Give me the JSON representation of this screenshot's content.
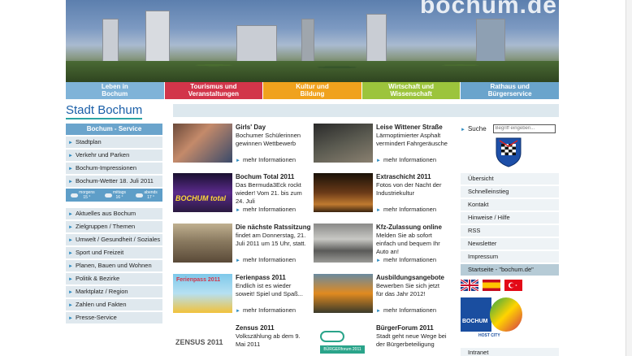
{
  "header": {
    "watermark": "bochum.de"
  },
  "mainnav": [
    {
      "line1": "Leben in",
      "line2": "Bochum",
      "color": "#7fb3d8"
    },
    {
      "line1": "Tourismus und",
      "line2": "Veranstaltungen",
      "color": "#d2354a"
    },
    {
      "line1": "Kultur und",
      "line2": "Bildung",
      "color": "#f0a21d"
    },
    {
      "line1": "Wirtschaft und",
      "line2": "Wissenschaft",
      "color": "#9cc43c"
    },
    {
      "line1": "Rathaus und",
      "line2": "Bürgerservice",
      "color": "#6aa4cc"
    }
  ],
  "logo": "Stadt Bochum",
  "leftnav": {
    "head": "Bochum - Service",
    "items": [
      "Stadtplan",
      "Verkehr und Parken",
      "Bochum-Impressionen",
      "Bochum-Wetter  18. Juli 2011"
    ],
    "weather": [
      {
        "label": "morgens",
        "temp": "15 °"
      },
      {
        "label": "mittags",
        "temp": "16 °"
      },
      {
        "label": "abends",
        "temp": "17 °"
      }
    ],
    "items2": [
      "Aktuelles aus Bochum",
      "Zielgruppen / Themen",
      "Umwelt / Gesundheit / Soziales",
      "Sport und Freizeit",
      "Planen, Bauen und Wohnen",
      "Politik & Bezirke",
      "Marktplatz / Region",
      "Zahlen und Fakten",
      "Presse-Service"
    ]
  },
  "news": [
    {
      "title": "Girls' Day",
      "text": "Bochumer Schülerinnen gewinnen Wettbewerb",
      "more": "mehr Informationen"
    },
    {
      "title": "Leise Wittener Straße",
      "text": "Lärmoptimierter Asphalt vermindert Fahrgeräusche",
      "more": "mehr Informationen"
    },
    {
      "title": "Bochum Total 2011",
      "text": "Das Bermuda3Eck rockt wieder! Vom 21. bis zum 24. Juli",
      "more": "mehr Informationen",
      "thumb_text": "BOCHUM total"
    },
    {
      "title": "Extraschicht 2011",
      "text": "Fotos von der Nacht der Industriekultur",
      "more": "mehr Informationen"
    },
    {
      "title": "Die nächste Ratssitzung",
      "text": "findet am Donnerstag, 21. Juli 2011 um 15 Uhr, statt.",
      "more": "mehr Informationen"
    },
    {
      "title": "Kfz-Zulassung online",
      "text": "Melden Sie ab sofort einfach und bequem Ihr Auto an!",
      "more": "mehr Informationen"
    },
    {
      "title": "Ferienpass 2011",
      "text": "Endlich ist es wieder soweit! Spiel und Spaß...",
      "more": "mehr Informationen",
      "thumb_text": "Ferienpass 2011"
    },
    {
      "title": "Ausbildungsangebote",
      "text": "Bewerben Sie sich jetzt für das Jahr 2012!",
      "more": "mehr Informationen"
    },
    {
      "title": "Zensus 2011",
      "text": "Volkszählung ab dem 9. Mai 2011",
      "more": "",
      "thumb_text": "ZENSUS 2011"
    },
    {
      "title": "BürgerForum 2011",
      "text": "Stadt geht neue Wege bei der Bürgerbeteiligung",
      "more": "",
      "thumb_text": "BÜRGERforum 2011"
    }
  ],
  "search": {
    "label": "Suche",
    "placeholder": "Begriff eingeben..."
  },
  "rightlinks": [
    "Übersicht",
    "Schnelleinstieg",
    "Kontakt",
    "Hinweise / Hilfe",
    "RSS",
    "Newsletter",
    "Impressum",
    "Startseite - \"bochum.de\""
  ],
  "hostcity": {
    "city": "BOCHUM",
    "sub": "HOST CITY"
  },
  "intranet": "Intranet"
}
